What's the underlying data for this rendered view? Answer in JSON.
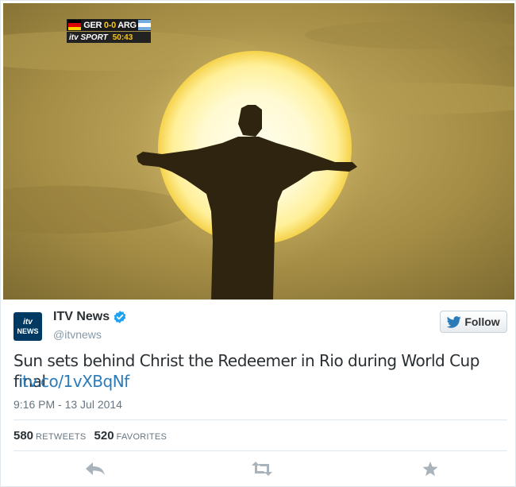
{
  "scorebug": {
    "home_team": "GER",
    "score": "0-0",
    "away_team": "ARG",
    "broadcaster": "itv SPORT",
    "clock": "50:43",
    "colors": {
      "ger_flag": [
        "#000000",
        "#dd0000",
        "#ffce00"
      ],
      "arg_flag": [
        "#74acdf",
        "#ffffff",
        "#74acdf"
      ]
    }
  },
  "tweet": {
    "avatar_line1": "itv",
    "avatar_line2": "NEWS",
    "display_name": "ITV News",
    "handle": "@itvnews",
    "follow_label": "Follow",
    "text": "Sun sets behind Christ the Redeemer in Rio during World Cup final",
    "link": "itv.co/1vXBqNf",
    "timestamp": "9:16 PM - 13 Jul 2014",
    "retweets_count": "580",
    "retweets_label": "RETWEETS",
    "favorites_count": "520",
    "favorites_label": "FAVORITES"
  },
  "icons": {
    "verified": "verified-badge-icon",
    "follow": "twitter-bird-icon",
    "reply": "reply-icon",
    "retweet": "retweet-icon",
    "favorite": "star-icon"
  },
  "colors": {
    "link": "#2b7bb9",
    "verified": "#1da1f2",
    "muted": "#8899a6",
    "action_icon": "#a8b3bb"
  }
}
